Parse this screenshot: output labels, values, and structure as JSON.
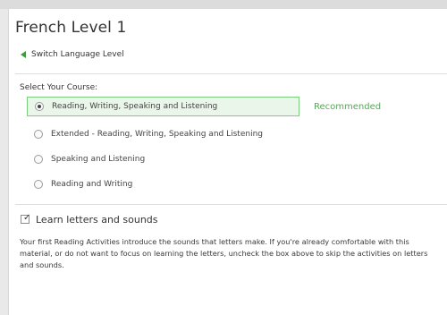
{
  "page": {
    "title": "French Level 1",
    "switch_link": "Switch Language Level"
  },
  "course": {
    "label": "Select Your Course:",
    "options": [
      {
        "label": "Reading, Writing, Speaking and Listening",
        "selected": true
      },
      {
        "label": "Extended - Reading, Writing, Speaking and Listening",
        "selected": false
      },
      {
        "label": "Speaking and Listening",
        "selected": false
      },
      {
        "label": "Reading and Writing",
        "selected": false
      }
    ],
    "recommended_label": "Recommended"
  },
  "letters": {
    "checkbox_label": "Learn letters and sounds",
    "checked": true,
    "description": "Your first Reading Activities introduce the sounds that letters make. If you're already comfortable with this material, or do not want to focus on learning the letters, uncheck the box above to skip the activities on letters and sounds."
  },
  "colors": {
    "accent_green": "#3e9a3e",
    "selected_border": "#7ccf7c",
    "selected_bg": "#eaf6ea",
    "recommended_text": "#5aa55a"
  },
  "icons": {
    "switch_arrow": "back-arrow-icon",
    "checkbox_mark": "check-icon"
  }
}
